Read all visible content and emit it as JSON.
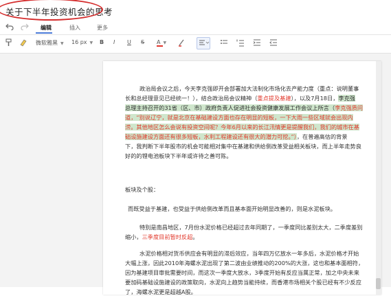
{
  "document": {
    "title": "关于下半年投资机会的思考"
  },
  "tabs": [
    {
      "label": "编辑"
    },
    {
      "label": "插入"
    },
    {
      "label": "更多"
    }
  ],
  "toolbar": {
    "font_family": "微软雅黑",
    "font_size": "16 px",
    "bold": "B",
    "italic": "I",
    "underline": "U",
    "strike": "S",
    "font_color_letter": "A",
    "text_color_hex": "#e0342b"
  },
  "icons": {
    "undo": "undo-icon",
    "redo": "redo-icon",
    "format_painter": "format-painter-icon",
    "eraser": "eraser-icon",
    "highlight": "highlighter-icon",
    "align": "align-icon",
    "list_bullet": "bullet-list-icon",
    "list_number": "numbered-list-icon",
    "indent": "indent-icon",
    "outdent": "outdent-icon"
  },
  "body": {
    "p1_l1": "政治局会议之后，今天李克强即开会部署加大法制化市场化去产能力度（重点：说明董事",
    "p1_l2a": "长和总经理意见已经统一！），结合政治局会议精神（",
    "p1_l2b": "重点提及基建",
    "p1_l2c": "），以及7月18日，",
    "p1_l2d": "李克强",
    "p1_l3a": "总理主持召开的31省（区、市）政府负责人促进社会投资健康发展工作会议上所言（",
    "p1_l3b": "李克强质问",
    "p1_l4": "道，“别说辽宁，就是北京在基础建设方面也存在明显的短板，一下大雨一些区域就会出现内",
    "p1_l5": "涝。其他地区怎么会说有投资空间呢？今年6月以来的长江汛情更是提醒我们，我们的城市在基",
    "p1_l6a": "础设施建设方面还有很多短板，水利工程建设还有很大的潜力可挖。”）",
    "p1_l6b": "，在普遍高估的背景",
    "p1_l7": "下，我判断下半年股市的机会可能相对集中在基建和供给侧改革受益相关板块，而上半年走势良",
    "p1_l8": "好的的锂电池板块下半年或许待之善可陈。",
    "heading": "板块及个股：",
    "p2": "而既受益于基建，也受益于供给侧改革而且基本面开始明显改善的，则是水泥板块。",
    "p3_l1": "特别是南昌地区，7月份水泥价格已经超过去年同期了，一季度同比差别太大，二季度差别",
    "p3_l2a": "缩小，",
    "p3_l2b": "三季度目前暂时反超",
    "p3_l2c": "。",
    "p4_l1": "水泥价格相对货币供应会有明显的滞后效应，当年四万亿放水一年多后，水泥价格才开始",
    "p4_l2": "大幅上涨，因此2010年海螺水泥出现了第二波由业绩推动的200%的大涨，这也和基本面相符，",
    "p4_l3": "因为基建项目审批需要时间，而这次一季度大放水，3季度开始有反应当属正常，加之中央未来",
    "p4_l4": "要加码基础设施建设的政策取向，水泥向上趋势当能持续，而香港市场相关个股已经有不少反应",
    "p4_l5": "了，海螺水泥更是超越A股。"
  }
}
